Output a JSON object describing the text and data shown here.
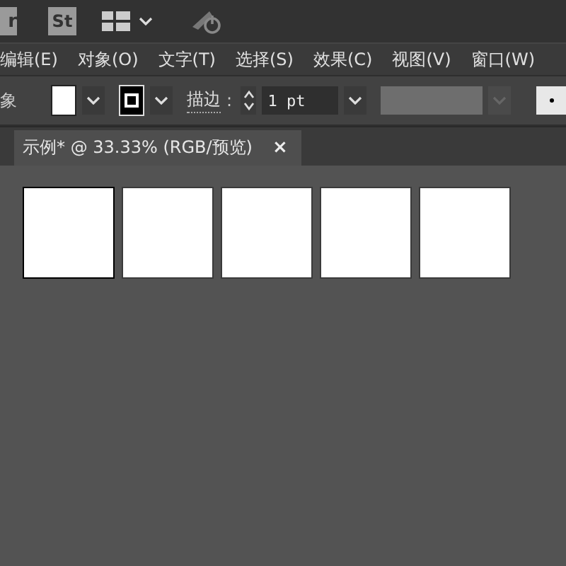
{
  "app_bar": {
    "bridge_icon_text": "r",
    "stock_icon_text": "St"
  },
  "menu": [
    "编辑(E)",
    "对象(O)",
    "文字(T)",
    "选择(S)",
    "效果(C)",
    "视图(V)",
    "窗口(W)"
  ],
  "control_bar": {
    "label": "象",
    "stroke_label": "描边",
    "stroke_colon": ":",
    "stroke_weight": "1 pt",
    "style_dropdown_disabled": true
  },
  "document_tab": {
    "title": "示例* @ 33.33% (RGB/预览)",
    "close": "×"
  },
  "artboards": [
    {
      "selected": true
    },
    {
      "selected": false
    },
    {
      "selected": false
    },
    {
      "selected": false
    },
    {
      "selected": false
    }
  ]
}
